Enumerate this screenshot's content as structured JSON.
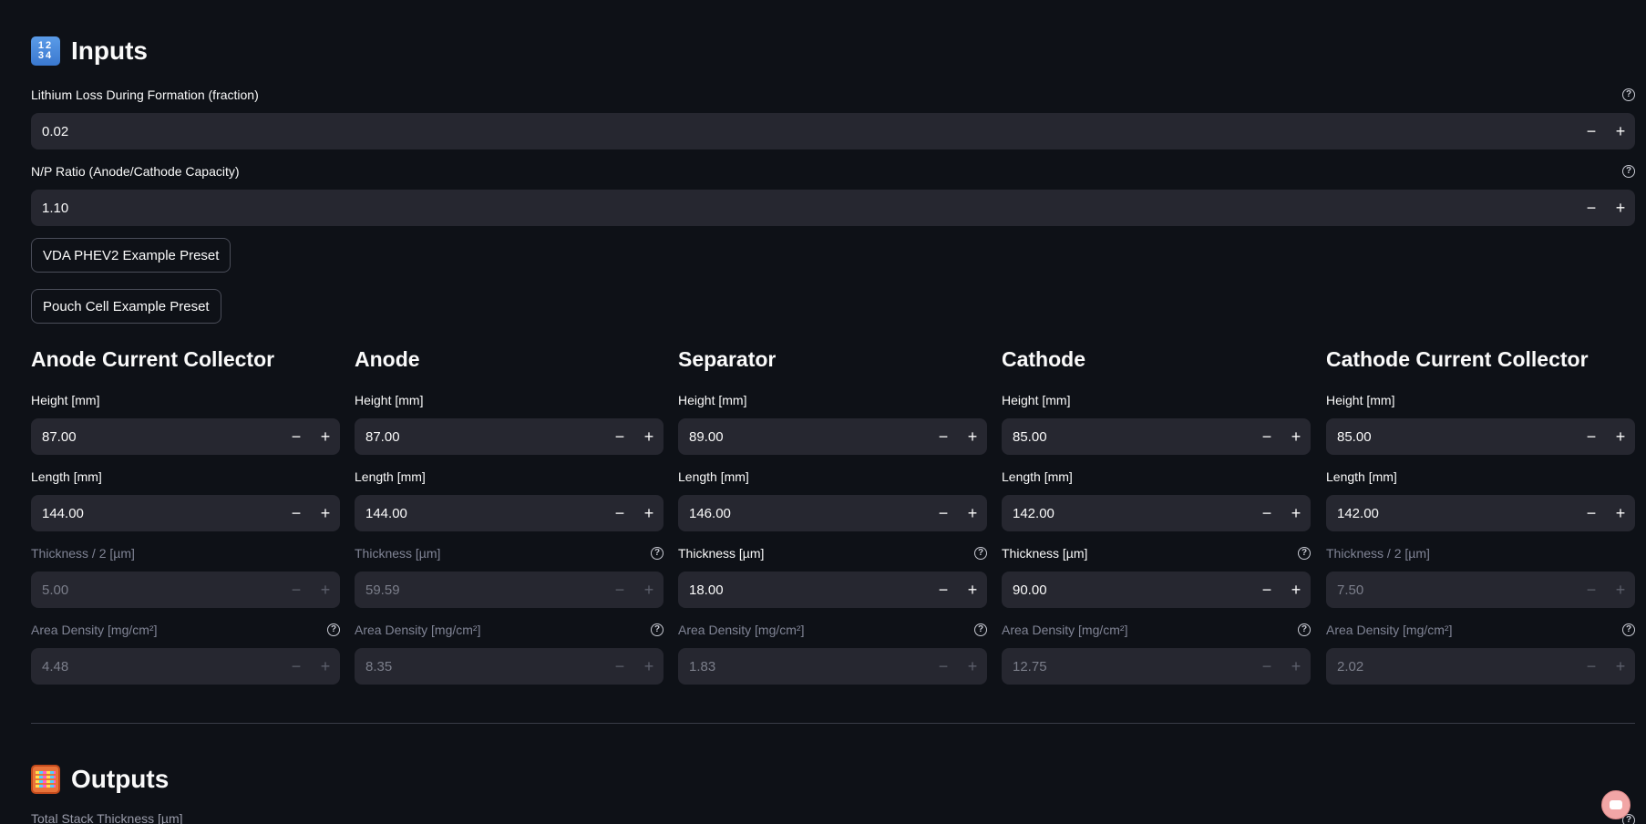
{
  "inputs_section": {
    "title": "Inputs",
    "emoji_top": "12",
    "emoji_bottom": "34"
  },
  "lithium_loss": {
    "label": "Lithium Loss During Formation (fraction)",
    "value": "0.02",
    "help_icon": "help-circle-icon"
  },
  "np_ratio": {
    "label": "N/P Ratio (Anode/Cathode Capacity)",
    "value": "1.10",
    "help_icon": "help-circle-icon"
  },
  "presets": {
    "vda": "VDA PHEV2 Example Preset",
    "pouch": "Pouch Cell Example Preset"
  },
  "step_labels": {
    "minus": "−",
    "plus": "+"
  },
  "columns": [
    {
      "title": "Anode Current Collector",
      "height": {
        "label": "Height [mm]",
        "value": "87.00"
      },
      "length": {
        "label": "Length [mm]",
        "value": "144.00"
      },
      "thickness": {
        "label": "Thickness / 2 [µm]",
        "value": "5.00",
        "disabled": true,
        "help": false
      },
      "area_density": {
        "label": "Area Density [mg/cm²]",
        "value": "4.48",
        "disabled": true
      }
    },
    {
      "title": "Anode",
      "height": {
        "label": "Height [mm]",
        "value": "87.00"
      },
      "length": {
        "label": "Length [mm]",
        "value": "144.00"
      },
      "thickness": {
        "label": "Thickness [µm]",
        "value": "59.59",
        "disabled": true,
        "help": true
      },
      "area_density": {
        "label": "Area Density [mg/cm²]",
        "value": "8.35",
        "disabled": true
      }
    },
    {
      "title": "Separator",
      "height": {
        "label": "Height [mm]",
        "value": "89.00"
      },
      "length": {
        "label": "Length [mm]",
        "value": "146.00"
      },
      "thickness": {
        "label": "Thickness [µm]",
        "value": "18.00",
        "disabled": false,
        "help": true
      },
      "area_density": {
        "label": "Area Density [mg/cm²]",
        "value": "1.83",
        "disabled": true
      }
    },
    {
      "title": "Cathode",
      "height": {
        "label": "Height [mm]",
        "value": "85.00"
      },
      "length": {
        "label": "Length [mm]",
        "value": "142.00"
      },
      "thickness": {
        "label": "Thickness [µm]",
        "value": "90.00",
        "disabled": false,
        "help": true
      },
      "area_density": {
        "label": "Area Density [mg/cm²]",
        "value": "12.75",
        "disabled": true
      }
    },
    {
      "title": "Cathode Current Collector",
      "height": {
        "label": "Height [mm]",
        "value": "85.00"
      },
      "length": {
        "label": "Length [mm]",
        "value": "142.00"
      },
      "thickness": {
        "label": "Thickness / 2 [µm]",
        "value": "7.50",
        "disabled": true,
        "help": false
      },
      "area_density": {
        "label": "Area Density [mg/cm²]",
        "value": "2.02",
        "disabled": true
      }
    }
  ],
  "outputs_section": {
    "title": "Outputs",
    "first_label": "Total Stack Thickness [µm]"
  },
  "colors": {
    "background": "#0e1117",
    "input_bg": "#262730",
    "text": "#fafafa",
    "disabled_text": "#808495"
  }
}
